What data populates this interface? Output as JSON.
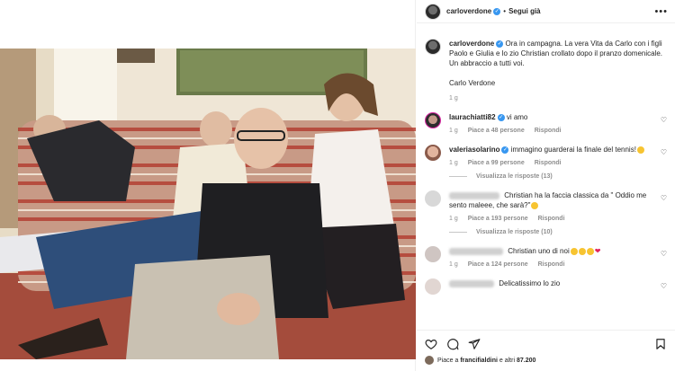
{
  "post": {
    "username": "carloverdone",
    "follow_label": "Segui già",
    "caption": "Ora in campagna. La vera Vita da Carlo con i figli Paolo e Giulia e lo zio Christian crollato dopo il pranzo domenicale. Un abbraccio a tutti voi.",
    "signature": "Carlo Verdone",
    "caption_time": "1 g"
  },
  "comments": [
    {
      "username": "laurachiatti82",
      "verified": true,
      "text": "vi amo",
      "time": "1 g",
      "likes": "Piace a 48 persone",
      "reply": "Rispondi"
    },
    {
      "username": "valeriasolarino",
      "verified": true,
      "text": "immagino guarderai la finale del tennis!",
      "time": "1 g",
      "likes": "Piace a 99 persone",
      "reply": "Rispondi",
      "view_replies": "Visualizza le risposte (13)"
    },
    {
      "username": "",
      "text": "Christian ha la faccia classica da \" Oddio me sento maleee, che sarà?\"",
      "time": "1 g",
      "likes": "Piace a 193 persone",
      "reply": "Rispondi",
      "view_replies": "Visualizza le risposte (10)"
    },
    {
      "username": "",
      "text": "Christian uno di noi",
      "time": "1 g",
      "likes": "Piace a 124 persone",
      "reply": "Rispondi"
    },
    {
      "username": "",
      "text": "Delicatissimo lo zio"
    }
  ],
  "footer": {
    "likes_prefix": "Piace a",
    "likes_user": "francifialdini",
    "likes_suffix": "e altri",
    "likes_count": "87.200"
  },
  "icons": {
    "like": "heart-outline-icon",
    "comment": "comment-icon",
    "share": "paper-plane-icon",
    "save": "bookmark-icon",
    "more": "more-icon",
    "verified": "verified-badge-icon"
  },
  "colors": {
    "verified": "#3897f0",
    "text_secondary": "#8e8e8e",
    "story_ring": "#d6249f"
  }
}
